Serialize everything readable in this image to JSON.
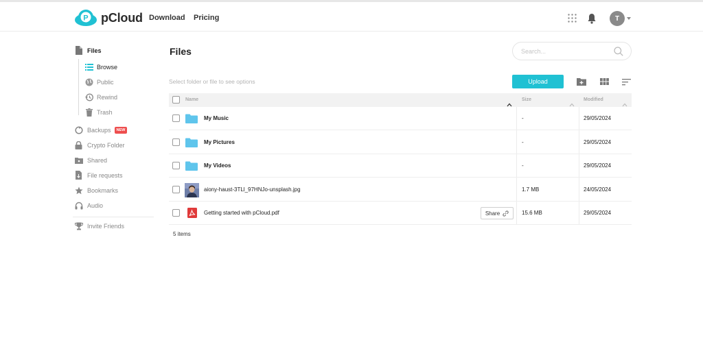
{
  "header": {
    "brand": "pCloud",
    "nav": [
      {
        "label": "Download"
      },
      {
        "label": "Pricing"
      }
    ],
    "avatar_initial": "T"
  },
  "sidebar": {
    "files": "Files",
    "sub_items": [
      {
        "label": "Browse",
        "icon": "list-icon",
        "active": true
      },
      {
        "label": "Public",
        "icon": "globe-icon"
      },
      {
        "label": "Rewind",
        "icon": "history-icon"
      },
      {
        "label": "Trash",
        "icon": "trash-icon"
      }
    ],
    "items": [
      {
        "label": "Backups",
        "icon": "backup-icon",
        "badge": "NEW"
      },
      {
        "label": "Crypto Folder",
        "icon": "lock-icon"
      },
      {
        "label": "Shared",
        "icon": "shared-icon"
      },
      {
        "label": "File requests",
        "icon": "file-request-icon"
      },
      {
        "label": "Bookmarks",
        "icon": "star-icon"
      },
      {
        "label": "Audio",
        "icon": "headphones-icon"
      }
    ],
    "invite": "Invite Friends"
  },
  "main": {
    "title": "Files",
    "search_placeholder": "Search...",
    "hint": "Select folder or file to see options",
    "upload_label": "Upload",
    "columns": {
      "name": "Name",
      "size": "Size",
      "modified": "Modified"
    },
    "rows": [
      {
        "name": "My Music",
        "type": "folder",
        "size": "-",
        "modified": "29/05/2024"
      },
      {
        "name": "My Pictures",
        "type": "folder",
        "size": "-",
        "modified": "29/05/2024"
      },
      {
        "name": "My Videos",
        "type": "folder",
        "size": "-",
        "modified": "29/05/2024"
      },
      {
        "name": "aiony-haust-3TLl_97HNJo-unsplash.jpg",
        "type": "image",
        "size": "1.7 MB",
        "modified": "24/05/2024"
      },
      {
        "name": "Getting started with pCloud.pdf",
        "type": "pdf",
        "size": "15.6 MB",
        "modified": "29/05/2024",
        "share_label": "Share"
      }
    ],
    "items_count": "5 items"
  },
  "colors": {
    "accent": "#20c1d3",
    "folder": "#5fc5ec",
    "pdf": "#e03a3a",
    "badge": "#ee4e4e"
  }
}
